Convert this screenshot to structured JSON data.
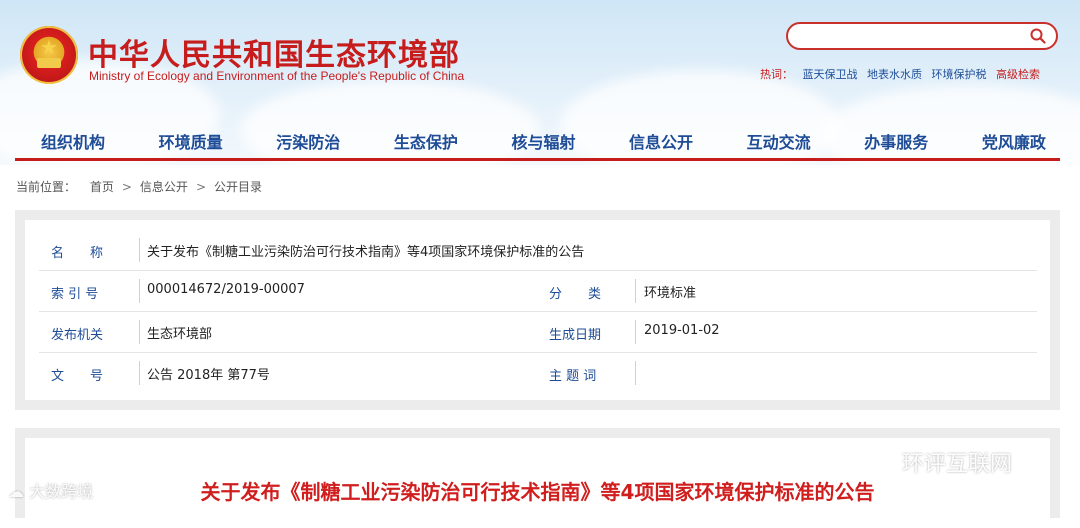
{
  "header": {
    "site_title": "中华人民共和国生态环境部",
    "site_subtitle": "Ministry of Ecology and Environment of the People's Republic of China",
    "search_placeholder": "",
    "hot_label": "热词：",
    "hot_words": [
      {
        "label": "蓝天保卫战"
      },
      {
        "label": "地表水水质"
      },
      {
        "label": "环境保护税"
      },
      {
        "label": "高级检索"
      }
    ]
  },
  "nav": {
    "items": [
      {
        "label": "组织机构"
      },
      {
        "label": "环境质量"
      },
      {
        "label": "污染防治"
      },
      {
        "label": "生态保护"
      },
      {
        "label": "核与辐射"
      },
      {
        "label": "信息公开"
      },
      {
        "label": "互动交流"
      },
      {
        "label": "办事服务"
      },
      {
        "label": "党风廉政"
      }
    ]
  },
  "breadcrumb": {
    "label": "当前位置：",
    "items": [
      {
        "label": "首页"
      },
      {
        "label": "信息公开"
      },
      {
        "label": "公开目录"
      }
    ],
    "sep": ">"
  },
  "info": {
    "name_key": "名　　称",
    "name_value": "关于发布《制糖工业污染防治可行技术指南》等4项国家环境保护标准的公告",
    "index_key": "索 引 号",
    "index_value": "000014672/2019-00007",
    "category_key": "分　　类",
    "category_value": "环境标准",
    "publisher_key": "发布机关",
    "publisher_value": "生态环境部",
    "date_key": "生成日期",
    "date_value": "2019-01-02",
    "doc_key": "文　　号",
    "doc_value": "公告 2018年 第77号",
    "subject_key": "主 题 词",
    "subject_value": ""
  },
  "article": {
    "title": "关于发布《制糖工业污染防治可行技术指南》等4项国家环境保护标准的公告"
  },
  "watermarks": {
    "left": "大数跨境",
    "right": "环评互联网"
  },
  "colors": {
    "brand_red": "#c61c1c",
    "nav_blue": "#1e4c96",
    "border_gray": "#ececec"
  }
}
